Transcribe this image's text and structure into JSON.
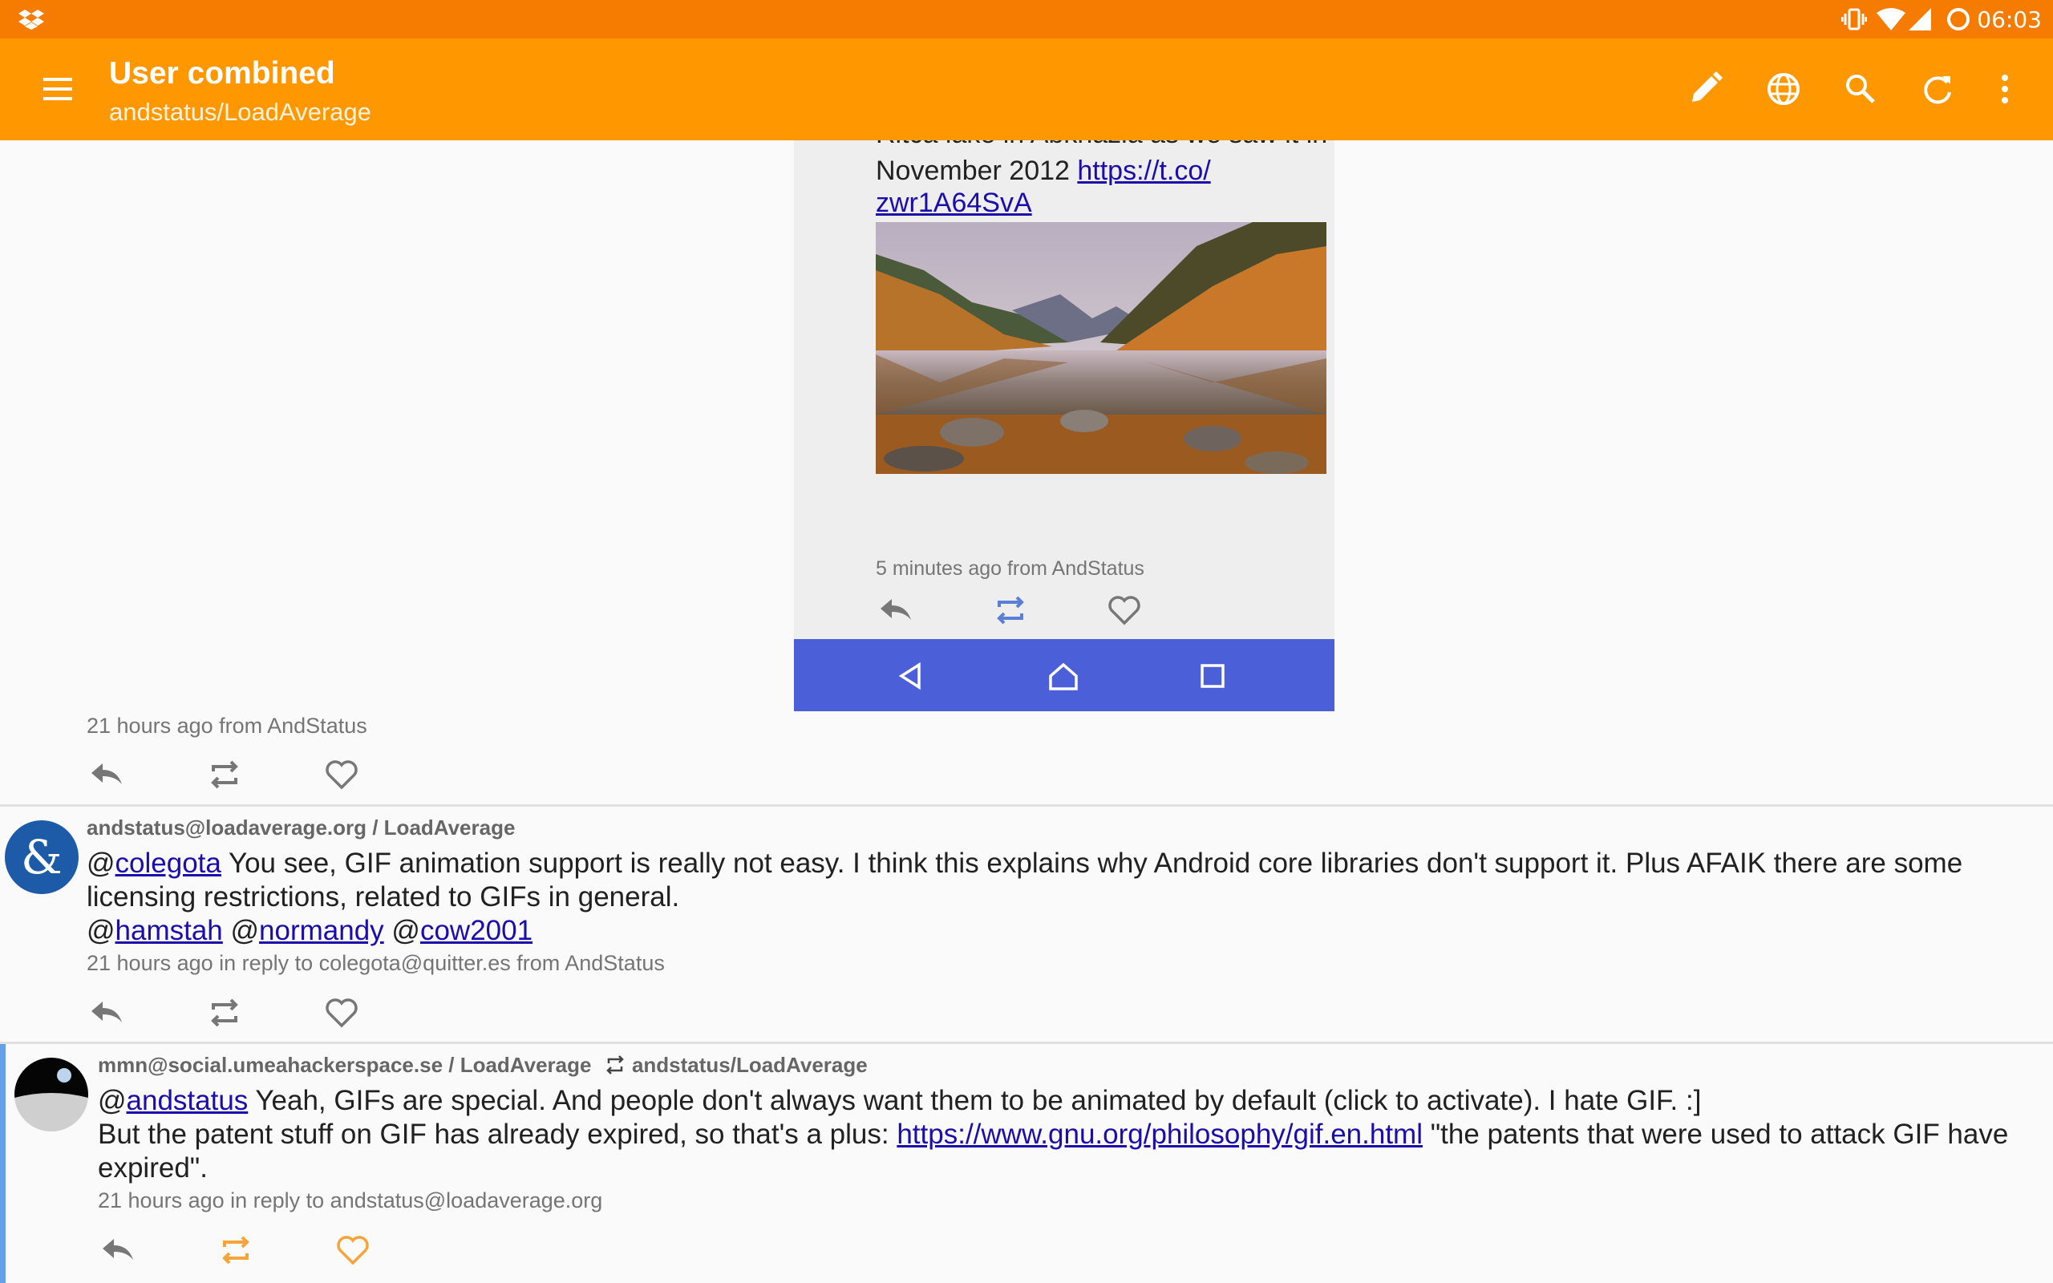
{
  "status_bar": {
    "time": "06:03"
  },
  "toolbar": {
    "title": "User combined",
    "subtitle": "andstatus/LoadAverage",
    "icons": [
      "menu-icon",
      "edit-icon",
      "globe-icon",
      "search-icon",
      "refresh-icon",
      "more-vert-icon"
    ]
  },
  "embedded_screenshot": {
    "cut_text": "Ritca lake in Abkhazia as we saw it in",
    "text_line": "November 2012 ",
    "link_part1": "https://t.co/",
    "link_part2": "zwr1A64SvA",
    "meta": "5 minutes ago from AndStatus",
    "nav_icons": [
      "back-icon",
      "home-icon",
      "recents-icon"
    ]
  },
  "posts": [
    {
      "meta": "21 hours ago from AndStatus"
    },
    {
      "author": "andstatus@loadaverage.org / LoadAverage",
      "mention1": "colegota",
      "text1": " You see, GIF animation support is really not easy. I think this explains why Android core libraries don't support it. Plus AFAIK there are some licensing restrictions, related to GIFs in general.",
      "mentions": [
        "hamstah",
        "normandy",
        "cow2001"
      ],
      "meta": "21 hours ago in reply to colegota@quitter.es from AndStatus"
    },
    {
      "author": "mmn@social.umeahackerspace.se / LoadAverage",
      "reblogged_by": "andstatus/LoadAverage",
      "mention1": "andstatus",
      "text1": " Yeah, GIFs are special. And people don't always want them to be animated by default (click to activate). I hate GIF. :]",
      "text2": "But the patent stuff on GIF has already expired, so that's a plus: ",
      "link": "https://www.gnu.org/philosophy/gif.en.html",
      "text3": " \"the patents that were used to attack GIF have expired\".",
      "meta": "21 hours ago in reply to andstatus@loadaverage.org"
    }
  ],
  "colors": {
    "status_bar": "#f57c00",
    "toolbar": "#ff9800",
    "nav_bar": "#4a5fd8",
    "active_action": "#f5a43a",
    "link": "#1a0dab"
  }
}
